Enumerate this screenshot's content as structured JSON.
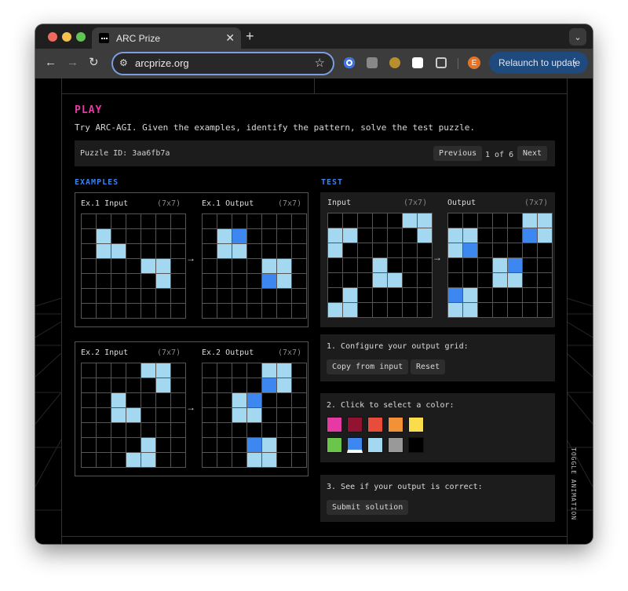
{
  "browser": {
    "tab_title": "ARC Prize",
    "tab_close_glyph": "✕",
    "new_tab_glyph": "+",
    "tab_menu_glyph": "⌄",
    "url": "arcprize.org",
    "nav": {
      "back": "←",
      "forward": "→",
      "reload": "↻"
    },
    "site_info_glyph": "⚙",
    "star_glyph": "☆",
    "profile_initial": "E",
    "relaunch_label": "Relaunch to update",
    "menu_glyph": "⋮"
  },
  "page": {
    "play_title": "PLAY",
    "intro": "Try ARC-AGI. Given the examples, identify the pattern, solve the test puzzle.",
    "puzzle_id_label": "Puzzle ID: 3aa6fb7a",
    "previous_label": "Previous",
    "page_count": "1 of 6",
    "next_label": "Next",
    "examples_label": "EXAMPLES",
    "test_label": "TEST",
    "arrow": "→",
    "toggle_animation": "TOGGLE ANIMATION"
  },
  "colors": {
    "0": "#000000",
    "1": "#3c87f0",
    "8": "#a3d8f0",
    "accent_pink": "#e53aa3",
    "accent_blue": "#3c82f0"
  },
  "examples": [
    {
      "input_label": "Ex.1 Input",
      "input_size": "(7x7)",
      "output_label": "Ex.1 Output",
      "output_size": "(7x7)",
      "input": [
        [
          0,
          0,
          0,
          0,
          0,
          0,
          0
        ],
        [
          0,
          8,
          0,
          0,
          0,
          0,
          0
        ],
        [
          0,
          8,
          8,
          0,
          0,
          0,
          0
        ],
        [
          0,
          0,
          0,
          0,
          8,
          8,
          0
        ],
        [
          0,
          0,
          0,
          0,
          0,
          8,
          0
        ],
        [
          0,
          0,
          0,
          0,
          0,
          0,
          0
        ],
        [
          0,
          0,
          0,
          0,
          0,
          0,
          0
        ]
      ],
      "output": [
        [
          0,
          0,
          0,
          0,
          0,
          0,
          0
        ],
        [
          0,
          8,
          1,
          0,
          0,
          0,
          0
        ],
        [
          0,
          8,
          8,
          0,
          0,
          0,
          0
        ],
        [
          0,
          0,
          0,
          0,
          8,
          8,
          0
        ],
        [
          0,
          0,
          0,
          0,
          1,
          8,
          0
        ],
        [
          0,
          0,
          0,
          0,
          0,
          0,
          0
        ],
        [
          0,
          0,
          0,
          0,
          0,
          0,
          0
        ]
      ]
    },
    {
      "input_label": "Ex.2 Input",
      "input_size": "(7x7)",
      "output_label": "Ex.2 Output",
      "output_size": "(7x7)",
      "input": [
        [
          0,
          0,
          0,
          0,
          8,
          8,
          0
        ],
        [
          0,
          0,
          0,
          0,
          0,
          8,
          0
        ],
        [
          0,
          0,
          8,
          0,
          0,
          0,
          0
        ],
        [
          0,
          0,
          8,
          8,
          0,
          0,
          0
        ],
        [
          0,
          0,
          0,
          0,
          0,
          0,
          0
        ],
        [
          0,
          0,
          0,
          0,
          8,
          0,
          0
        ],
        [
          0,
          0,
          0,
          8,
          8,
          0,
          0
        ]
      ],
      "output": [
        [
          0,
          0,
          0,
          0,
          8,
          8,
          0
        ],
        [
          0,
          0,
          0,
          0,
          1,
          8,
          0
        ],
        [
          0,
          0,
          8,
          1,
          0,
          0,
          0
        ],
        [
          0,
          0,
          8,
          8,
          0,
          0,
          0
        ],
        [
          0,
          0,
          0,
          0,
          0,
          0,
          0
        ],
        [
          0,
          0,
          0,
          1,
          8,
          0,
          0
        ],
        [
          0,
          0,
          0,
          8,
          8,
          0,
          0
        ]
      ]
    }
  ],
  "test": {
    "input_label": "Input",
    "input_size": "(7x7)",
    "output_label": "Output",
    "output_size": "(7x7)",
    "input": [
      [
        0,
        0,
        0,
        0,
        0,
        8,
        8
      ],
      [
        8,
        8,
        0,
        0,
        0,
        0,
        8
      ],
      [
        8,
        0,
        0,
        0,
        0,
        0,
        0
      ],
      [
        0,
        0,
        0,
        8,
        0,
        0,
        0
      ],
      [
        0,
        0,
        0,
        8,
        8,
        0,
        0
      ],
      [
        0,
        8,
        0,
        0,
        0,
        0,
        0
      ],
      [
        8,
        8,
        0,
        0,
        0,
        0,
        0
      ]
    ],
    "output": [
      [
        0,
        0,
        0,
        0,
        0,
        8,
        8
      ],
      [
        8,
        8,
        0,
        0,
        0,
        1,
        8
      ],
      [
        8,
        1,
        0,
        0,
        0,
        0,
        0
      ],
      [
        0,
        0,
        0,
        8,
        1,
        0,
        0
      ],
      [
        0,
        0,
        0,
        8,
        8,
        0,
        0
      ],
      [
        1,
        8,
        0,
        0,
        0,
        0,
        0
      ],
      [
        8,
        8,
        0,
        0,
        0,
        0,
        0
      ]
    ]
  },
  "step1": {
    "label": "1. Configure your output grid:",
    "copy_label": "Copy from input",
    "reset_label": "Reset"
  },
  "step2": {
    "label": "2. Click to select a color:",
    "palette": [
      {
        "name": "magenta",
        "hex": "#e53aa3"
      },
      {
        "name": "maroon",
        "hex": "#921231"
      },
      {
        "name": "red",
        "hex": "#e84d3c"
      },
      {
        "name": "orange",
        "hex": "#f39137"
      },
      {
        "name": "yellow",
        "hex": "#fbdd4b"
      },
      {
        "name": "green",
        "hex": "#6cc54b"
      },
      {
        "name": "blue",
        "hex": "#3c87f0",
        "selected": true
      },
      {
        "name": "light-blue",
        "hex": "#a3d8f0"
      },
      {
        "name": "gray",
        "hex": "#999999"
      },
      {
        "name": "black",
        "hex": "#000000"
      }
    ]
  },
  "step3": {
    "label": "3. See if your output is correct:",
    "submit_label": "Submit solution"
  }
}
